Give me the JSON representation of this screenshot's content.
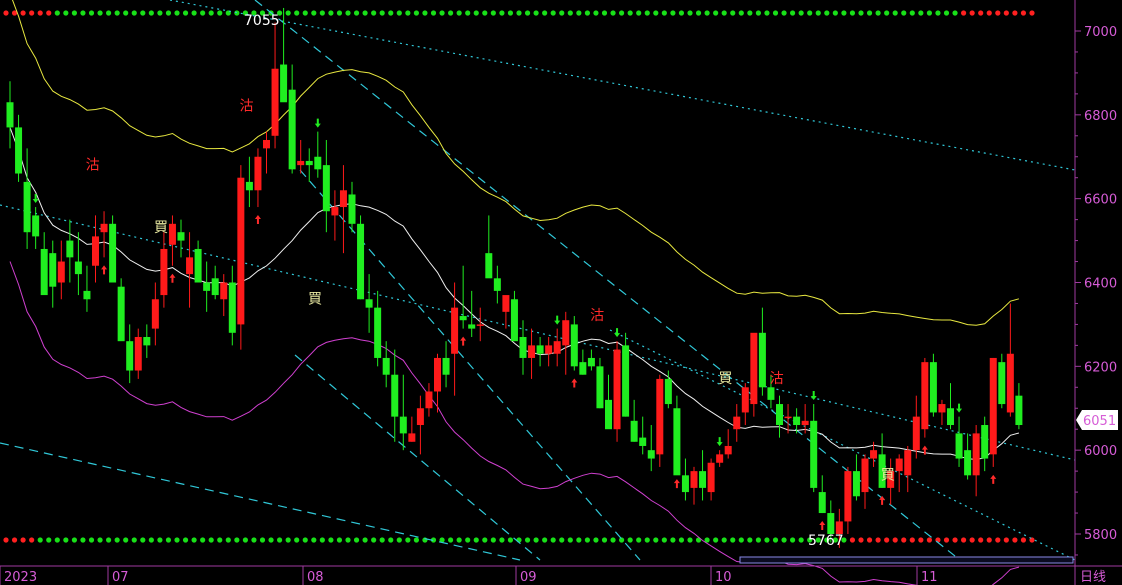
{
  "chart_data": {
    "type": "candlestick",
    "yaxis": {
      "ticks": [
        7000,
        6800,
        6600,
        6400,
        6200,
        6000,
        5800
      ],
      "range": [
        5745,
        7075
      ]
    },
    "xaxis": {
      "labels": [
        "2023",
        "07",
        "08",
        "09",
        "10",
        "11",
        "日线"
      ]
    },
    "current_price": 6051,
    "high_label": "7055",
    "low_label": "5767",
    "colors": {
      "up": "#ff1a1a",
      "down": "#20ee20",
      "ma_long": "#e8e840",
      "ma_mid": "#f0f0f0",
      "ma_low": "#d040d0",
      "trend": "#30c8d8",
      "background": "#000000",
      "axis": "#d65cd6"
    },
    "candles": [
      [
        6830,
        6880,
        6720,
        6770
      ],
      [
        6770,
        6800,
        6640,
        6660
      ],
      [
        6640,
        6720,
        6480,
        6520
      ],
      [
        6560,
        6580,
        6480,
        6510
      ],
      [
        6480,
        6520,
        6380,
        6370
      ],
      [
        6470,
        6500,
        6340,
        6390
      ],
      [
        6400,
        6500,
        6360,
        6450
      ],
      [
        6500,
        6550,
        6400,
        6460
      ],
      [
        6450,
        6520,
        6370,
        6420
      ],
      [
        6380,
        6440,
        6330,
        6360
      ],
      [
        6440,
        6560,
        6400,
        6510
      ],
      [
        6520,
        6570,
        6460,
        6540
      ],
      [
        6540,
        6560,
        6420,
        6400
      ],
      [
        6390,
        6410,
        6280,
        6260
      ],
      [
        6260,
        6300,
        6160,
        6190
      ],
      [
        6190,
        6290,
        6170,
        6270
      ],
      [
        6270,
        6300,
        6220,
        6250
      ],
      [
        6290,
        6400,
        6250,
        6360
      ],
      [
        6370,
        6520,
        6340,
        6480
      ],
      [
        6490,
        6560,
        6440,
        6540
      ],
      [
        6520,
        6550,
        6460,
        6500
      ],
      [
        6420,
        6520,
        6340,
        6460
      ],
      [
        6480,
        6500,
        6400,
        6400
      ],
      [
        6400,
        6450,
        6330,
        6380
      ],
      [
        6410,
        6440,
        6360,
        6370
      ],
      [
        6360,
        6420,
        6320,
        6400
      ],
      [
        6400,
        6440,
        6250,
        6280
      ],
      [
        6300,
        6680,
        6240,
        6650
      ],
      [
        6640,
        6700,
        6580,
        6620
      ],
      [
        6620,
        6720,
        6580,
        6700
      ],
      [
        6720,
        6760,
        6660,
        6740
      ],
      [
        6750,
        7020,
        6720,
        6910
      ],
      [
        6920,
        7055,
        6860,
        6830
      ],
      [
        6860,
        6920,
        6660,
        6670
      ],
      [
        6680,
        6740,
        6660,
        6690
      ],
      [
        6690,
        6720,
        6640,
        6680
      ],
      [
        6700,
        6760,
        6650,
        6670
      ],
      [
        6680,
        6740,
        6520,
        6570
      ],
      [
        6560,
        6620,
        6500,
        6580
      ],
      [
        6580,
        6680,
        6470,
        6620
      ],
      [
        6610,
        6640,
        6520,
        6540
      ],
      [
        6540,
        6560,
        6360,
        6360
      ],
      [
        6360,
        6420,
        6280,
        6340
      ],
      [
        6340,
        6380,
        6200,
        6220
      ],
      [
        6220,
        6260,
        6150,
        6180
      ],
      [
        6180,
        6240,
        6020,
        6080
      ],
      [
        6080,
        6180,
        6000,
        6040
      ],
      [
        6020,
        6080,
        6020,
        6040
      ],
      [
        6060,
        6130,
        5990,
        6100
      ],
      [
        6100,
        6160,
        6080,
        6140
      ],
      [
        6140,
        6230,
        6090,
        6220
      ],
      [
        6220,
        6260,
        6150,
        6180
      ],
      [
        6230,
        6400,
        6130,
        6340
      ],
      [
        6320,
        6440,
        6290,
        6310
      ],
      [
        6300,
        6380,
        6270,
        6290
      ],
      [
        6300,
        6340,
        6260,
        6300
      ],
      [
        6470,
        6560,
        6430,
        6410
      ],
      [
        6410,
        6440,
        6350,
        6380
      ],
      [
        6330,
        6360,
        6290,
        6370
      ],
      [
        6360,
        6380,
        6260,
        6260
      ],
      [
        6270,
        6310,
        6180,
        6220
      ],
      [
        6220,
        6290,
        6170,
        6250
      ],
      [
        6250,
        6270,
        6200,
        6230
      ],
      [
        6230,
        6270,
        6200,
        6250
      ],
      [
        6230,
        6290,
        6200,
        6260
      ],
      [
        6250,
        6330,
        6180,
        6310
      ],
      [
        6300,
        6320,
        6190,
        6200
      ],
      [
        6210,
        6240,
        6180,
        6180
      ],
      [
        6220,
        6240,
        6190,
        6200
      ],
      [
        6200,
        6220,
        6100,
        6100
      ],
      [
        6120,
        6180,
        6060,
        6050
      ],
      [
        6050,
        6260,
        6020,
        6240
      ],
      [
        6250,
        6280,
        6080,
        6080
      ],
      [
        6070,
        6120,
        6020,
        6020
      ],
      [
        6030,
        6080,
        5990,
        6010
      ],
      [
        6000,
        6060,
        5950,
        5980
      ],
      [
        5990,
        6180,
        5960,
        6170
      ],
      [
        6170,
        6190,
        6100,
        6110
      ],
      [
        6100,
        6130,
        5950,
        5940
      ],
      [
        5940,
        5980,
        5880,
        5900
      ],
      [
        5910,
        5960,
        5870,
        5950
      ],
      [
        5950,
        6000,
        5880,
        5910
      ],
      [
        5900,
        5980,
        5880,
        5970
      ],
      [
        5970,
        6000,
        5960,
        5990
      ],
      [
        5990,
        6050,
        5980,
        6010
      ],
      [
        6050,
        6110,
        6020,
        6080
      ],
      [
        6090,
        6160,
        6060,
        6150
      ],
      [
        6110,
        6240,
        6080,
        6280
      ],
      [
        6280,
        6340,
        6130,
        6150
      ],
      [
        6150,
        6180,
        6100,
        6120
      ],
      [
        6110,
        6130,
        6030,
        6060
      ],
      [
        6080,
        6110,
        6040,
        6080
      ],
      [
        6080,
        6100,
        6040,
        6060
      ],
      [
        6060,
        6110,
        6040,
        6070
      ],
      [
        6070,
        6110,
        5900,
        5910
      ],
      [
        5900,
        5940,
        5850,
        5850
      ],
      [
        5850,
        5880,
        5780,
        5800
      ],
      [
        5800,
        5860,
        5767,
        5830
      ],
      [
        5830,
        5960,
        5800,
        5950
      ],
      [
        5950,
        5990,
        5880,
        5890
      ],
      [
        5900,
        5990,
        5860,
        5980
      ],
      [
        5980,
        6020,
        5960,
        6000
      ],
      [
        5990,
        6040,
        5910,
        5910
      ],
      [
        5910,
        5980,
        5870,
        5950
      ],
      [
        5950,
        5990,
        5900,
        5980
      ],
      [
        5940,
        6010,
        5900,
        6000
      ],
      [
        6000,
        6130,
        5980,
        6080
      ],
      [
        6050,
        6220,
        6030,
        6210
      ],
      [
        6210,
        6230,
        6080,
        6090
      ],
      [
        6090,
        6120,
        6060,
        6110
      ],
      [
        6100,
        6160,
        6050,
        6060
      ],
      [
        6040,
        6080,
        5960,
        5980
      ],
      [
        6000,
        6040,
        5930,
        5940
      ],
      [
        5940,
        6060,
        5890,
        6040
      ],
      [
        6060,
        6080,
        5950,
        5980
      ],
      [
        5990,
        6220,
        5960,
        6220
      ],
      [
        6210,
        6230,
        6100,
        6110
      ],
      [
        6090,
        6350,
        6080,
        6230
      ],
      [
        6130,
        6160,
        6050,
        6060
      ]
    ],
    "annotations": [
      {
        "text": "沽",
        "index": 3,
        "price": 6670,
        "color": "#ff2a2a"
      },
      {
        "text": "沽",
        "index": 21,
        "price": 6810,
        "color": "#ff2a2a"
      },
      {
        "text": "買",
        "index": 11,
        "price": 6520,
        "color": "#e8e8a0"
      },
      {
        "text": "買",
        "index": 29,
        "price": 6350,
        "color": "#e8e8a0"
      },
      {
        "text": "沽",
        "index": 62,
        "price": 6310,
        "color": "#ff2a2a"
      },
      {
        "text": "買",
        "index": 77,
        "price": 6160,
        "color": "#e8e8a0"
      },
      {
        "text": "沽",
        "index": 83,
        "price": 6160,
        "color": "#ff2a2a"
      },
      {
        "text": "買",
        "index": 96,
        "price": 5930,
        "color": "#e8e8a0"
      }
    ]
  }
}
